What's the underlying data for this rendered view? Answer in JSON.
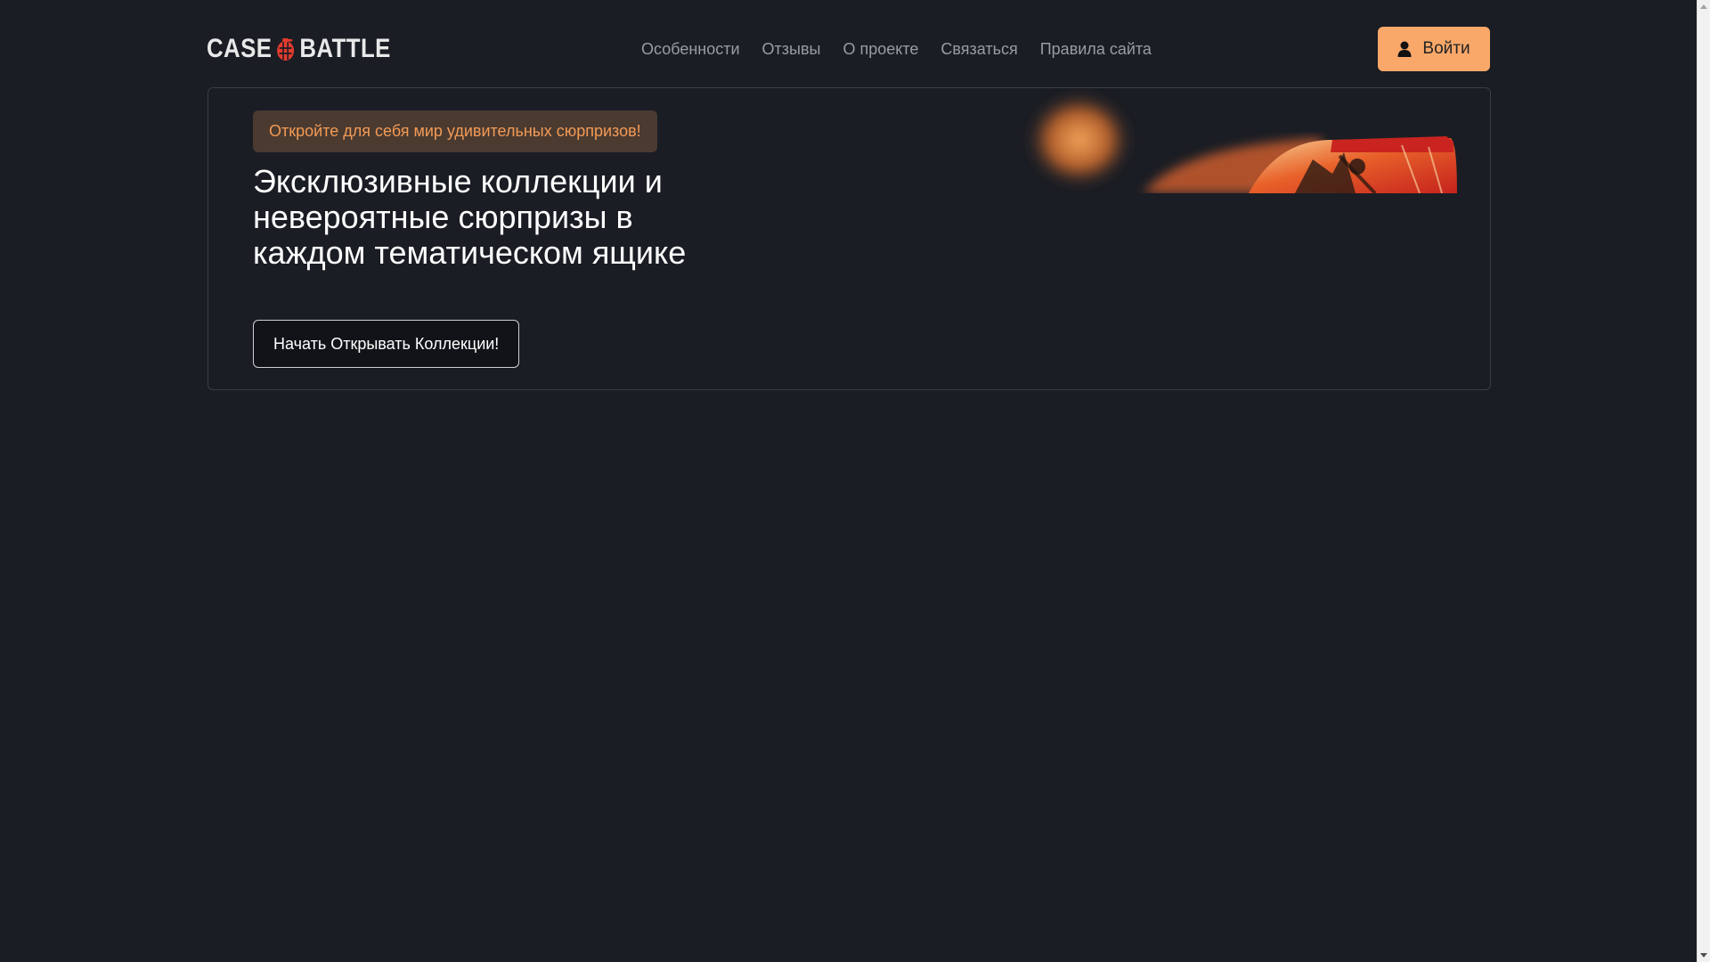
{
  "header": {
    "logo": {
      "left": "CASE",
      "right": "BATTLE",
      "icon": "grenade-icon"
    },
    "nav": [
      {
        "label": "Особенности"
      },
      {
        "label": "Отзывы"
      },
      {
        "label": "О проекте"
      },
      {
        "label": "Связаться"
      },
      {
        "label": "Правила сайта"
      }
    ],
    "login": {
      "label": "Войти",
      "icon": "user-icon"
    }
  },
  "hero": {
    "badge": "Откройте для себя мир удивительных сюрпризов!",
    "title": "Эксклюзивные коллекции и невероятные сюрпризы в каждом тематическом ящике",
    "cta": "Начать Открывать Коллекции!"
  },
  "colors": {
    "background": "#1a1d24",
    "accent": "#f9a86a",
    "badge_bg": "#4a3a30",
    "badge_text": "#f39a55",
    "nav_text": "#9a9ca3"
  }
}
